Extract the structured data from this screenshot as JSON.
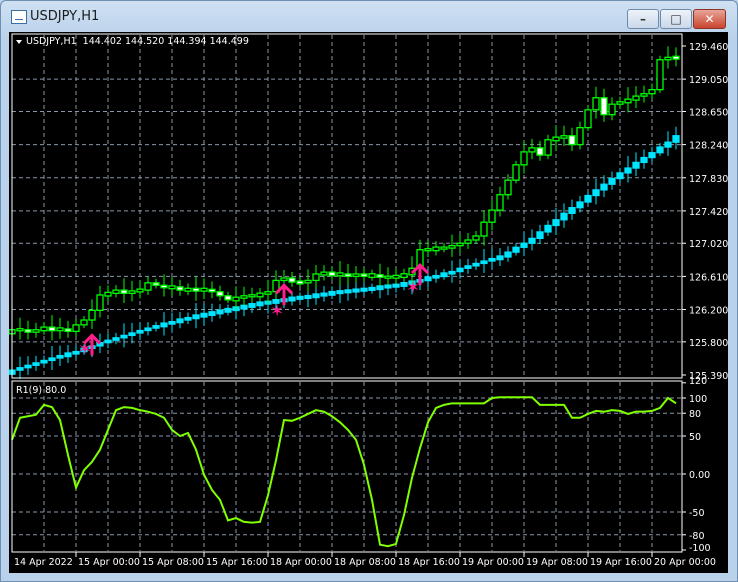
{
  "window": {
    "title": "USDJPY,H1",
    "minimize_label": "–",
    "maximize_label": "□",
    "close_label": "✕"
  },
  "header": {
    "symbol_info": "USDJPY,H1  144.402 144.520 144.394 144.499"
  },
  "indicator": {
    "label": "R1(9) 80.0"
  },
  "colors": {
    "bg": "#000000",
    "upper_candles": "#00ff00",
    "lower_candles": "#00e5ff",
    "indicator_line": "#7fff00",
    "signals": "#ff1e8c",
    "grid": "#8a96a8"
  },
  "chart_data": [
    {
      "type": "candlestick",
      "price_axis_ticks": [
        "129.460",
        "129.050",
        "128.650",
        "128.240",
        "127.830",
        "127.420",
        "127.020",
        "126.610",
        "126.200",
        "125.800",
        "125.390"
      ],
      "ylim": [
        125.39,
        129.46
      ],
      "time_labels": [
        "14 Apr 2022",
        "15 Apr 00:00",
        "15 Apr 08:00",
        "15 Apr 16:00",
        "18 Apr 00:00",
        "18 Apr 08:00",
        "18 Apr 16:00",
        "19 Apr 00:00",
        "19 Apr 08:00",
        "19 Apr 16:00",
        "20 Apr 00:00"
      ],
      "grid": true,
      "upper_series_close": [
        125.95,
        125.95,
        125.92,
        125.95,
        125.97,
        125.95,
        125.96,
        125.93,
        126.01,
        126.07,
        126.19,
        126.38,
        126.4,
        126.44,
        126.4,
        126.43,
        126.44,
        126.53,
        126.5,
        126.47,
        126.48,
        126.44,
        126.45,
        126.44,
        126.45,
        126.42,
        126.37,
        126.32,
        126.34,
        126.37,
        126.37,
        126.39,
        126.42,
        126.56,
        126.59,
        126.54,
        126.53,
        126.56,
        126.64,
        126.65,
        126.63,
        126.64,
        126.61,
        126.64,
        126.61,
        126.63,
        126.6,
        126.6,
        126.61,
        126.63,
        126.71,
        126.94,
        126.94,
        126.96,
        126.96,
        126.99,
        127.02,
        127.06,
        127.11,
        127.28,
        127.43,
        127.62,
        127.8,
        127.99,
        128.15,
        128.2,
        128.11,
        128.3,
        128.32,
        128.35,
        128.24,
        128.45,
        128.67,
        128.82,
        128.61,
        128.74,
        128.77,
        128.79,
        128.84,
        128.87,
        128.92,
        129.29,
        129.32,
        129.31
      ],
      "lower_series_close": [
        125.45,
        125.48,
        125.51,
        125.54,
        125.57,
        125.6,
        125.63,
        125.65,
        125.68,
        125.72,
        125.75,
        125.79,
        125.82,
        125.85,
        125.88,
        125.91,
        125.94,
        125.97,
        126.0,
        126.02,
        126.05,
        126.07,
        126.1,
        126.12,
        126.14,
        126.16,
        126.18,
        126.2,
        126.22,
        126.24,
        126.26,
        126.28,
        126.29,
        126.31,
        126.32,
        126.34,
        126.35,
        126.36,
        126.38,
        126.39,
        126.41,
        126.42,
        126.43,
        126.44,
        126.45,
        126.46,
        126.48,
        126.49,
        126.5,
        126.52,
        126.54,
        126.57,
        126.59,
        126.62,
        126.64,
        126.67,
        126.71,
        126.74,
        126.77,
        126.8,
        126.83,
        126.85,
        126.91,
        126.97,
        127.02,
        127.08,
        127.16,
        127.24,
        127.31,
        127.39,
        127.46,
        127.53,
        127.61,
        127.68,
        127.75,
        127.82,
        127.89,
        127.95,
        128.02,
        128.08,
        128.14,
        128.21,
        128.27,
        128.35
      ],
      "buy_arrows": [
        {
          "bar": 10,
          "price": 125.88
        },
        {
          "bar": 34,
          "price": 126.5
        },
        {
          "bar": 51,
          "price": 126.75
        }
      ],
      "stars": [
        {
          "bar": 9,
          "price": 125.72
        },
        {
          "bar": 33,
          "price": 126.19
        },
        {
          "bar": 50,
          "price": 126.48
        }
      ]
    },
    {
      "type": "line",
      "name": "R1(9) 80.0",
      "axis_ticks": [
        "120",
        "100",
        "80",
        "50",
        "0.00",
        "-50",
        "-80",
        "-100"
      ],
      "ylim": [
        -100,
        120
      ],
      "values": [
        45,
        74,
        76,
        78,
        91,
        88,
        71,
        25,
        -18,
        5,
        16,
        32,
        58,
        84,
        88,
        87,
        84,
        82,
        79,
        74,
        58,
        50,
        54,
        32,
        -1,
        -21,
        -34,
        -61,
        -58,
        -63,
        -64,
        -63,
        -28,
        18,
        71,
        70,
        74,
        79,
        84,
        82,
        76,
        68,
        58,
        45,
        12,
        -34,
        -93,
        -95,
        -92,
        -54,
        -5,
        34,
        68,
        87,
        91,
        93,
        93,
        93,
        93,
        93,
        100,
        101,
        101,
        101,
        101,
        101,
        91,
        91,
        91,
        91,
        74,
        74,
        79,
        83,
        82,
        84,
        83,
        79,
        82,
        82,
        83,
        87,
        100,
        93
      ]
    }
  ]
}
